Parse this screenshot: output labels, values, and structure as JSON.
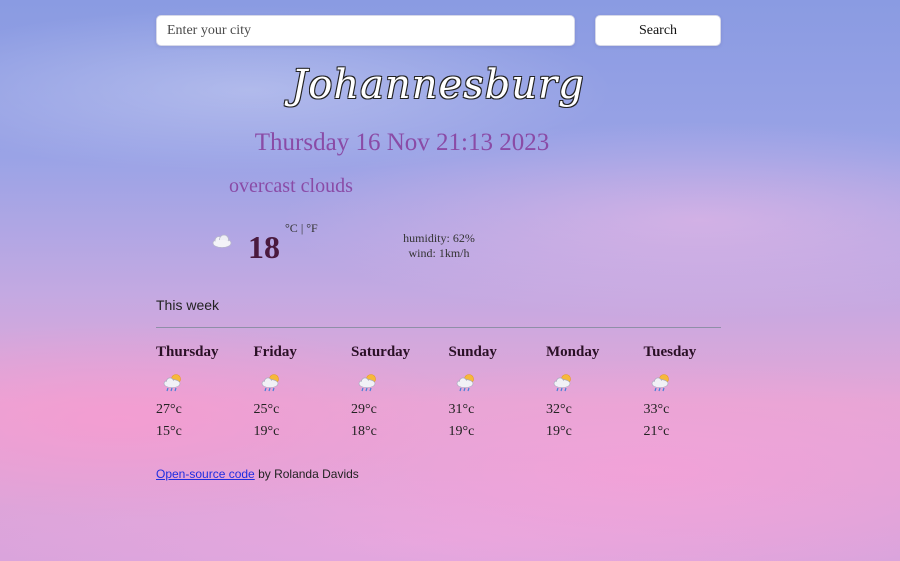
{
  "search": {
    "placeholder": "Enter your city",
    "button_label": "Search"
  },
  "current": {
    "city": "Johannesburg",
    "datetime": "Thursday 16 Nov 21:13 2023",
    "description": "overcast clouds",
    "icon": "cloud-icon",
    "temperature": "18",
    "unit_c": "°C",
    "unit_separator": " | ",
    "unit_f": "°F",
    "humidity": "humidity: 62%",
    "wind": "wind: 1km/h"
  },
  "week": {
    "label": "This week",
    "days": [
      {
        "name": "Thursday",
        "icon": "rain-cloud-icon",
        "max": "27°c",
        "min": "15°c"
      },
      {
        "name": "Friday",
        "icon": "rain-cloud-icon",
        "max": "25°c",
        "min": "19°c"
      },
      {
        "name": "Saturday",
        "icon": "rain-cloud-icon",
        "max": "29°c",
        "min": "18°c"
      },
      {
        "name": "Sunday",
        "icon": "rain-cloud-icon",
        "max": "31°c",
        "min": "19°c"
      },
      {
        "name": "Monday",
        "icon": "rain-cloud-icon",
        "max": "32°c",
        "min": "19°c"
      },
      {
        "name": "Tuesday",
        "icon": "rain-cloud-icon",
        "max": "33°c",
        "min": "21°c"
      }
    ]
  },
  "footer": {
    "link_text": "Open-source code",
    "suffix": " by Rolanda Davids"
  }
}
